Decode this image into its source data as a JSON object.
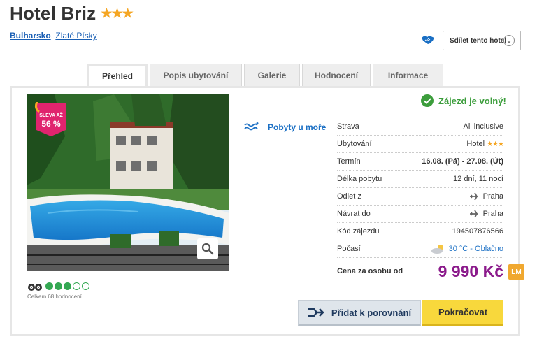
{
  "hotel": {
    "name": "Hotel Briz",
    "stars": "★★★"
  },
  "breadcrumb": {
    "country": "Bulharsko",
    "separator": ",",
    "resort": "Zlaté Písky"
  },
  "share": {
    "label": "Sdílet tento hotel"
  },
  "tabs": [
    {
      "label": "Přehled",
      "active": true
    },
    {
      "label": "Popis ubytování",
      "active": false
    },
    {
      "label": "Galerie",
      "active": false
    },
    {
      "label": "Hodnocení",
      "active": false
    },
    {
      "label": "Informace",
      "active": false
    }
  ],
  "badge": {
    "line1": "SLEVA AŽ",
    "line2": "56 %"
  },
  "reviews": {
    "rating": 3,
    "max": 5,
    "count_text": "Celkem 68 hodnocení"
  },
  "sea_category": "Pobyty u moře",
  "availability": "Zájezd je volný!",
  "details": {
    "strava": {
      "label": "Strava",
      "value": "All inclusive"
    },
    "ubytovani": {
      "label": "Ubytování",
      "value": "Hotel",
      "stars": "★★★"
    },
    "termin": {
      "label": "Termín",
      "value": "16.08. (Pá) - 27.08. (Út)"
    },
    "delka": {
      "label": "Délka pobytu",
      "value": "12 dní, 11 nocí"
    },
    "odlet": {
      "label": "Odlet z",
      "value": "Praha"
    },
    "navrat": {
      "label": "Návrat do",
      "value": "Praha"
    },
    "kod": {
      "label": "Kód zájezdu",
      "value": "194507876566"
    },
    "pocasi": {
      "label": "Počasí",
      "value": "30 °C - Oblačno"
    }
  },
  "price": {
    "label": "Cena za osobu od",
    "value": "9 990 Kč",
    "badge": "LM"
  },
  "buttons": {
    "compare": "Přidat k porovnání",
    "continue": "Pokračovat"
  },
  "colors": {
    "price": "#8b1a8b",
    "available": "#3c9d3c",
    "link": "#1a6fc4",
    "primary_button": "#f8d83c",
    "badge": "#e0246e"
  }
}
